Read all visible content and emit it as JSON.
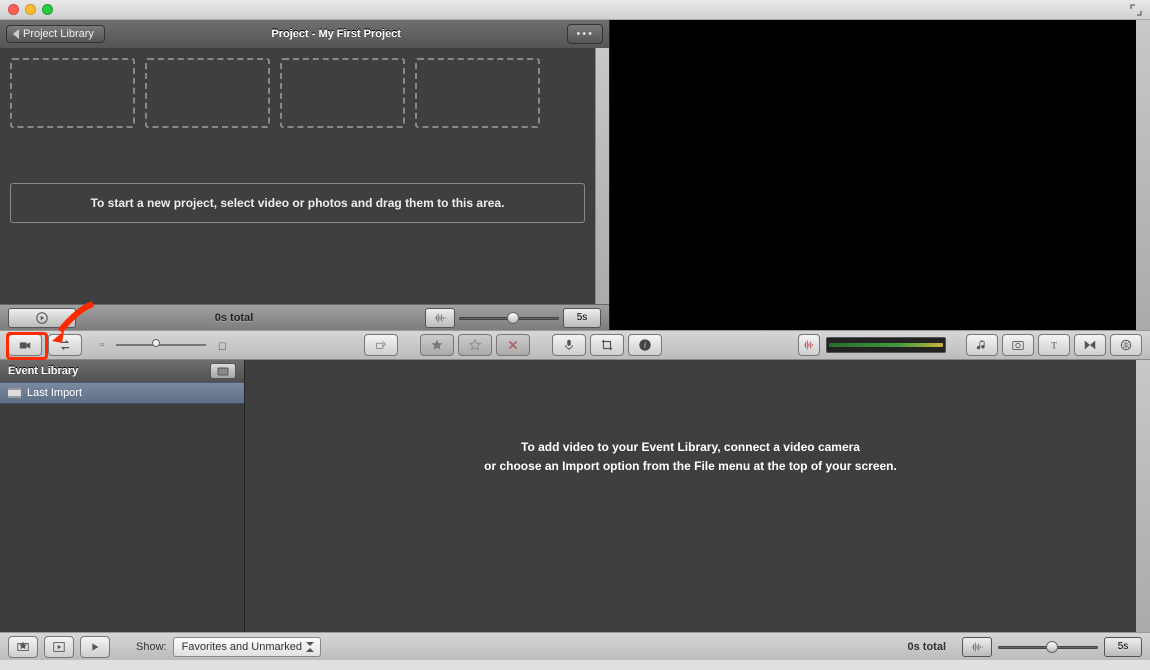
{
  "header": {
    "back_label": "Project Library",
    "title": "Project - My First Project"
  },
  "project": {
    "dropzone_text": "To start a new project, select video or photos and drag them to this area.",
    "total_label": "0s total",
    "duration_label": "5s"
  },
  "sidebar": {
    "title": "Event Library",
    "items": [
      "Last Import"
    ]
  },
  "event": {
    "empty_line1": "To add video to your Event Library, connect a video camera",
    "empty_line2": "or choose an Import option from the File menu at the top of your screen."
  },
  "footer": {
    "show_label": "Show:",
    "filter_value": "Favorites and Unmarked",
    "total_label": "0s total",
    "duration_label": "5s"
  },
  "icons": {
    "camera": "camera-icon",
    "swap": "swap-icon",
    "star_filled": "star-filled-icon",
    "star_outline": "star-outline-icon",
    "reject": "reject-icon",
    "mic": "mic-icon",
    "crop": "crop-icon",
    "info": "info-icon",
    "music": "music-icon",
    "photo": "photo-icon",
    "title": "title-icon",
    "transition": "transition-icon",
    "globe": "globe-icon",
    "waveform": "waveform-icon"
  }
}
